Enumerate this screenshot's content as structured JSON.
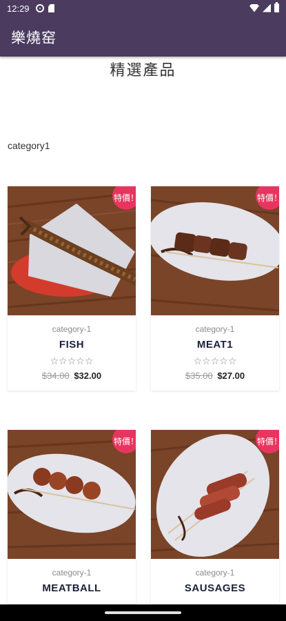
{
  "status_bar": {
    "time": "12:29"
  },
  "app_bar": {
    "title": "樂燒窑"
  },
  "page": {
    "title": "精選產品",
    "category": "category1"
  },
  "products": [
    {
      "category": "category-1",
      "name": "FISH",
      "old_price": "$34.00",
      "price": "$32.00",
      "badge": "特價！",
      "stars": "☆☆☆☆☆",
      "rating": 0
    },
    {
      "category": "category-1",
      "name": "MEAT1",
      "old_price": "$35.00",
      "price": "$27.00",
      "badge": "特價！",
      "stars": "☆☆☆☆☆",
      "rating": 0
    },
    {
      "category": "category-1",
      "name": "MEATBALL",
      "badge": "特價！"
    },
    {
      "category": "category-1",
      "name": "SAUSAGES",
      "badge": "特價！"
    }
  ],
  "colors": {
    "app_bar": "#4a3b5f",
    "sale_badge": "#e8355f",
    "product_name": "#1a2138"
  },
  "icons": {
    "status_left": [
      "settings-icon",
      "sd-card-icon"
    ],
    "status_right": [
      "wifi-icon",
      "signal-icon",
      "battery-icon"
    ]
  }
}
